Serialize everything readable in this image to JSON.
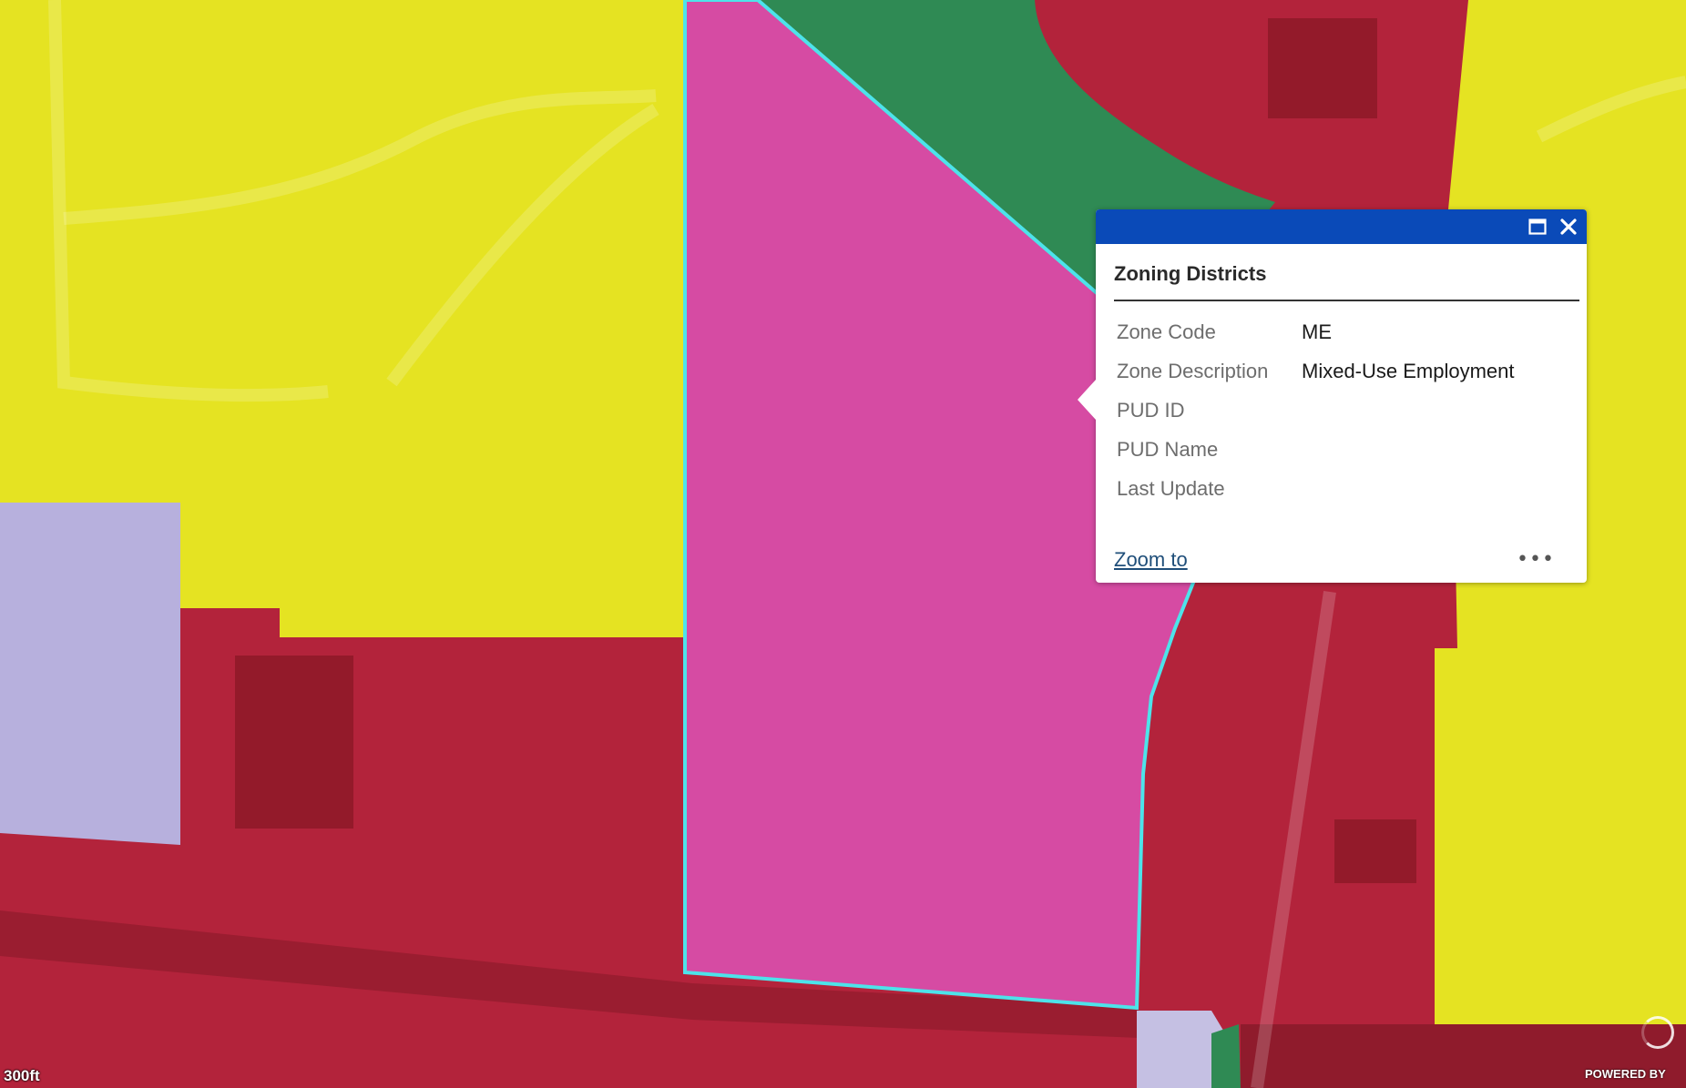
{
  "popup": {
    "title": "Zoning Districts",
    "fields": [
      {
        "label": "Zone Code",
        "value": "ME"
      },
      {
        "label": "Zone Description",
        "value": "Mixed-Use Employment"
      },
      {
        "label": "PUD ID",
        "value": ""
      },
      {
        "label": "PUD Name",
        "value": ""
      },
      {
        "label": "Last Update",
        "value": ""
      }
    ],
    "zoom_label": "Zoom to",
    "more_label": "•••",
    "header_color": "#0a4ab8",
    "maximize_icon": "maximize-icon",
    "close_icon": "close-icon"
  },
  "map": {
    "scale_text": "300ft",
    "attribution": "POWERED BY",
    "zone_colors": {
      "residential": "#e5e322",
      "commercial": "#b3233b",
      "mixed_use_employment": "#d64ba3",
      "open_space": "#2f8a54",
      "institutional": "#b7b0dd",
      "selection_outline": "#4de3ea"
    }
  }
}
